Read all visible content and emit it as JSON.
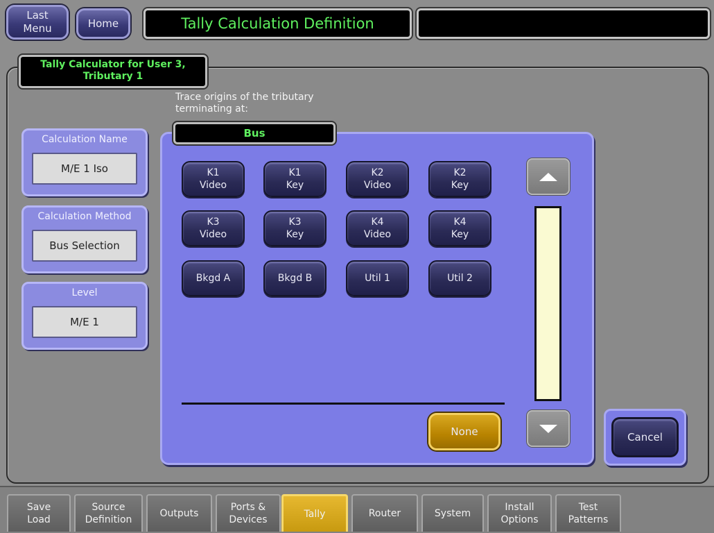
{
  "header": {
    "last_menu": "Last\nMenu",
    "home": "Home",
    "title": "Tally Calculation Definition",
    "status": ""
  },
  "tab_label": "Tally Calculator for User 3,\nTributary 1",
  "left_panels": [
    {
      "title": "Calculation Name",
      "value": "M/E 1 Iso"
    },
    {
      "title": "Calculation Method",
      "value": "Bus Selection"
    },
    {
      "title": "Level",
      "value": "M/E 1"
    }
  ],
  "trace_label": "Trace origins of the tributary\nterminating at:",
  "bus_label": "Bus",
  "bus_buttons": [
    "K1\nVideo",
    "K1\nKey",
    "K2\nVideo",
    "K2\nKey",
    "K3\nVideo",
    "K3\nKey",
    "K4\nVideo",
    "K4\nKey",
    "Bkgd A",
    "Bkgd B",
    "Util 1",
    "Util 2"
  ],
  "none_button": "None",
  "cancel_button": "Cancel",
  "bottom_tabs": [
    {
      "label": "Save\nLoad",
      "active": false
    },
    {
      "label": "Source\nDefinition",
      "active": false
    },
    {
      "label": "Outputs",
      "active": false
    },
    {
      "label": "Ports &\nDevices",
      "active": false
    },
    {
      "label": "Tally",
      "active": true
    },
    {
      "label": "Router",
      "active": false
    },
    {
      "label": "System",
      "active": false
    },
    {
      "label": "Install\nOptions",
      "active": false
    },
    {
      "label": "Test\nPatterns",
      "active": false
    }
  ],
  "colors": {
    "title_text": "#5ff05f",
    "panel_blue": "#7c7ce6",
    "active_tab": "#e6b830",
    "scroll_track": "#fafad2"
  },
  "icons": [
    "up-arrow-icon",
    "down-arrow-icon"
  ]
}
